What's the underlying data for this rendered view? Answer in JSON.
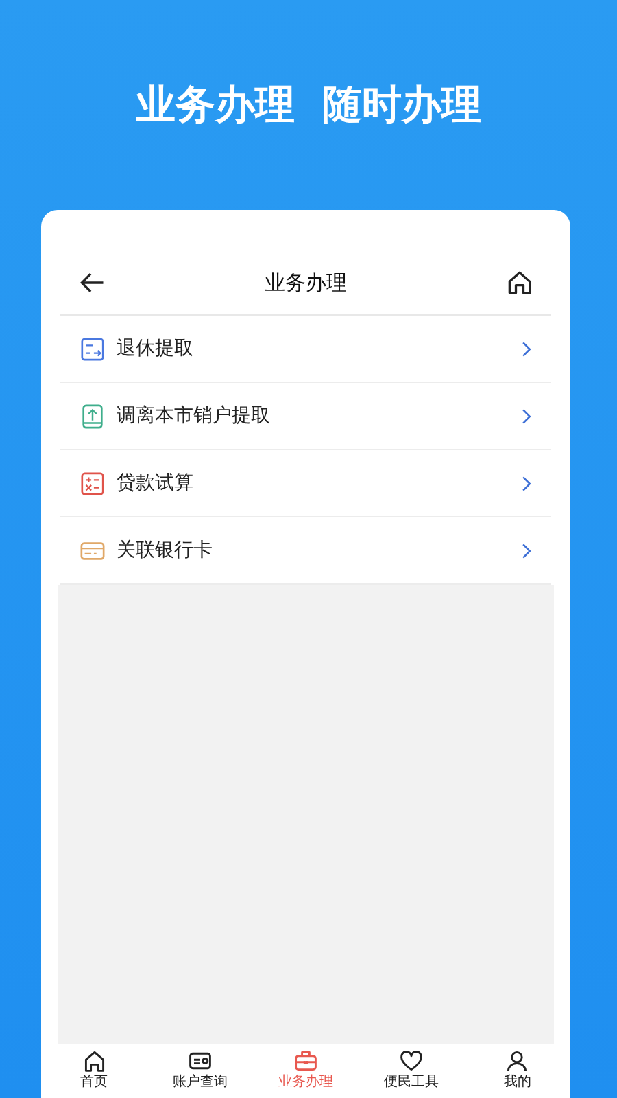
{
  "banner": {
    "title": "业务办理  随时办理"
  },
  "header": {
    "title": "业务办理"
  },
  "items": [
    {
      "label": "退休提取",
      "kind": "retire",
      "color": "#4a78e0"
    },
    {
      "label": "调离本市销户提取",
      "kind": "transfer",
      "color": "#3fae8c"
    },
    {
      "label": "贷款试算",
      "kind": "calc",
      "color": "#e0534a"
    },
    {
      "label": "关联银行卡",
      "kind": "card",
      "color": "#e0a868"
    }
  ],
  "tabs": [
    {
      "label": "首页",
      "kind": "home",
      "selected": false
    },
    {
      "label": "账户查询",
      "kind": "account",
      "selected": false
    },
    {
      "label": "业务办理",
      "kind": "briefcase",
      "selected": true
    },
    {
      "label": "便民工具",
      "kind": "heart",
      "selected": false
    },
    {
      "label": "我的",
      "kind": "user",
      "selected": false
    }
  ]
}
